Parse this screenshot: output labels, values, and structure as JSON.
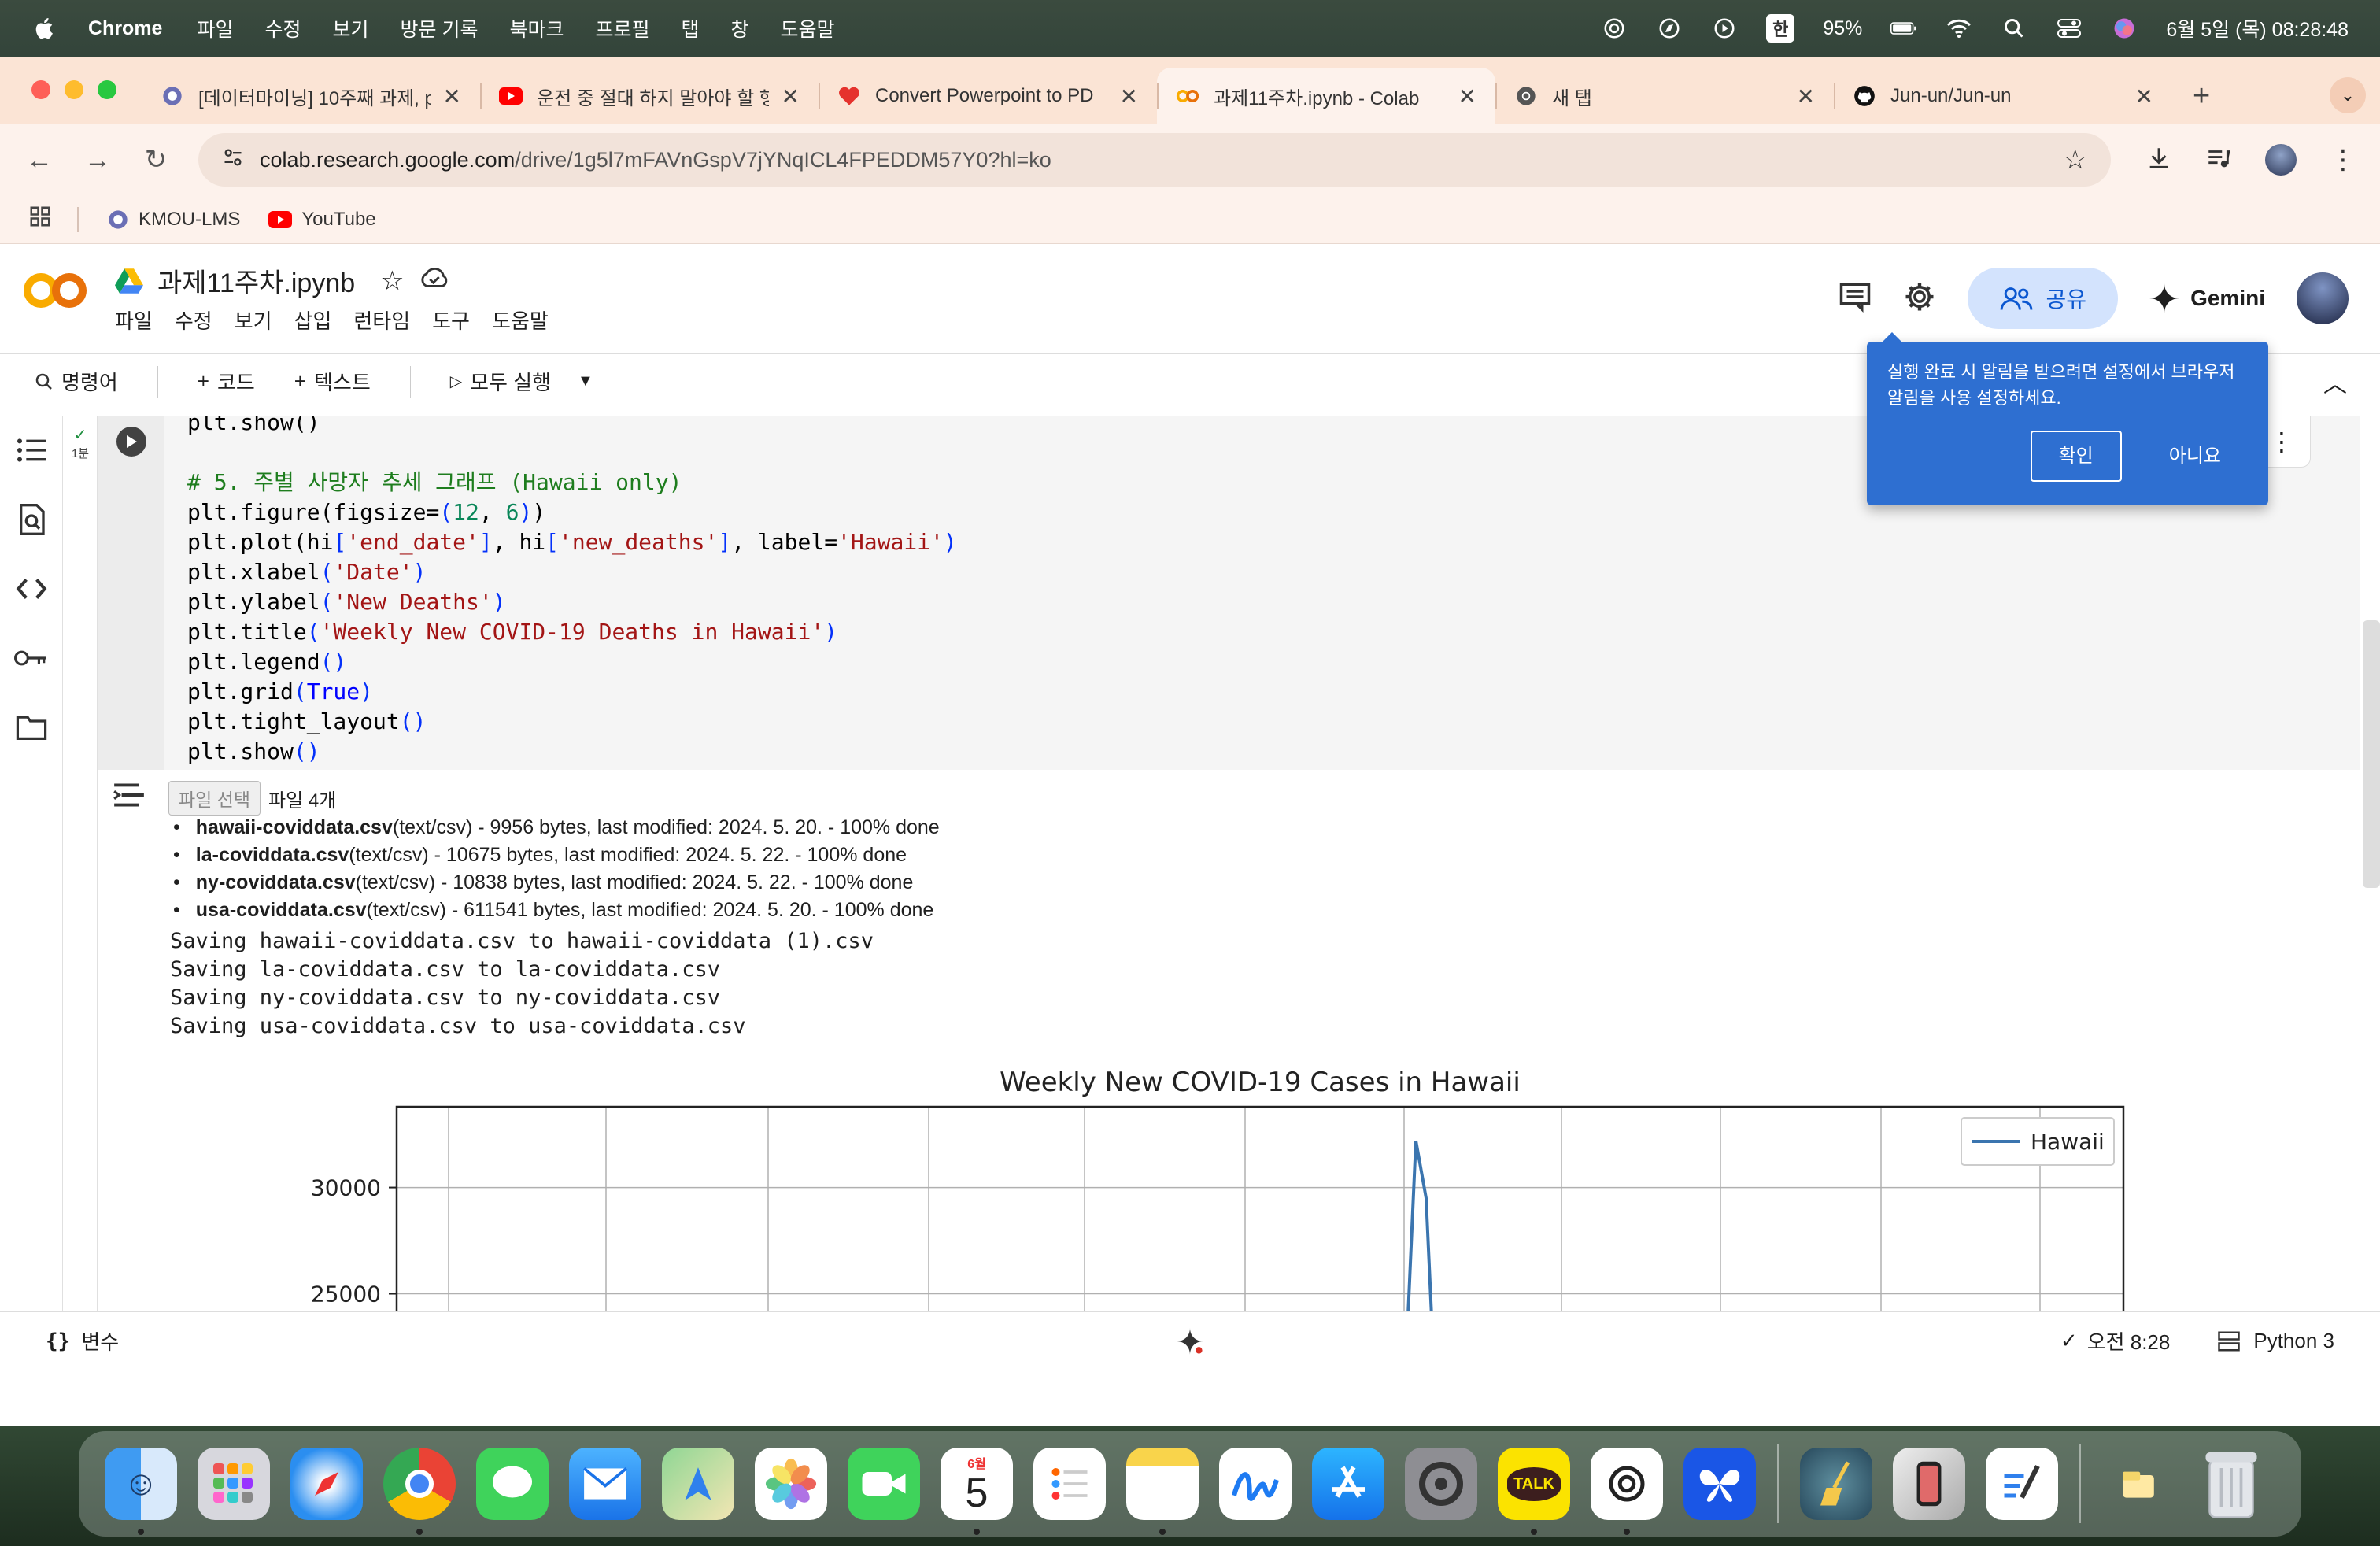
{
  "menubar": {
    "app_name": "Chrome",
    "items": [
      "파일",
      "수정",
      "보기",
      "방문 기록",
      "북마크",
      "프로필",
      "탭",
      "창",
      "도움말"
    ],
    "battery": "95%",
    "ime": "한",
    "datetime": "6월 5일 (목) 08:28:48"
  },
  "tabs": [
    {
      "title": "[데이터마이닝] 10주째 과제, p",
      "icon": "kmou-icon"
    },
    {
      "title": "운전 중 절대 하지 말아야 할 행",
      "icon": "youtube-icon"
    },
    {
      "title": "Convert Powerpoint to PD",
      "icon": "heart-icon"
    },
    {
      "title": "과제11주차.ipynb - Colab",
      "icon": "colab-icon",
      "active": true
    },
    {
      "title": "새 탭",
      "icon": "chrome-icon"
    },
    {
      "title": "Jun-un/Jun-un",
      "icon": "github-icon"
    }
  ],
  "address": {
    "host": "colab.research.google.com",
    "path": "/drive/1g5l7mFAVnGspV7jYNqICL4FPEDDM57Y0?hl=ko"
  },
  "bookmarks": [
    {
      "label": "KMOU-LMS",
      "icon": "kmou-icon"
    },
    {
      "label": "YouTube",
      "icon": "youtube-icon"
    }
  ],
  "notebook": {
    "title": "과제11주차.ipynb",
    "menu": [
      "파일",
      "수정",
      "보기",
      "삽입",
      "런타임",
      "도구",
      "도움말"
    ],
    "share_label": "공유",
    "gemini_label": "Gemini"
  },
  "colab_toolbar": {
    "commands": "명령어",
    "code": "코드",
    "text": "텍스트",
    "run_all": "모두 실행"
  },
  "cell": {
    "exec_time": "1분",
    "code_lines": [
      "plt.show()",
      "",
      "# 5. 주별 사망자 추세 그래프 (Hawaii only)",
      "plt.figure(figsize=(12, 6))",
      "plt.plot(hi['end_date'], hi['new_deaths'], label='Hawaii')",
      "plt.xlabel('Date')",
      "plt.ylabel('New Deaths')",
      "plt.title('Weekly New COVID-19 Deaths in Hawaii')",
      "plt.legend()",
      "plt.grid(True)",
      "plt.tight_layout()",
      "plt.show()"
    ]
  },
  "output": {
    "file_button": "파일 선택",
    "file_count": "파일 4개",
    "files": [
      {
        "name": "hawaii-coviddata.csv",
        "info": "(text/csv) - 9956 bytes, last modified: 2024. 5. 20. - 100% done"
      },
      {
        "name": "la-coviddata.csv",
        "info": "(text/csv) - 10675 bytes, last modified: 2024. 5. 22. - 100% done"
      },
      {
        "name": "ny-coviddata.csv",
        "info": "(text/csv) - 10838 bytes, last modified: 2024. 5. 22. - 100% done"
      },
      {
        "name": "usa-coviddata.csv",
        "info": "(text/csv) - 611541 bytes, last modified: 2024. 5. 20. - 100% done"
      }
    ],
    "saving": [
      "Saving hawaii-coviddata.csv to hawaii-coviddata (1).csv",
      "Saving la-coviddata.csv to la-coviddata.csv",
      "Saving ny-coviddata.csv to ny-coviddata.csv",
      "Saving usa-coviddata.csv to usa-coviddata.csv"
    ]
  },
  "chart_data": {
    "type": "line",
    "title": "Weekly New COVID-19 Cases in Hawaii",
    "series": [
      {
        "name": "Hawaii",
        "color": "#3b75af"
      }
    ],
    "y_ticks": [
      30000,
      25000
    ],
    "y_visible_range": [
      21500,
      33800
    ],
    "visible_peak": {
      "y": 32200
    },
    "legend": "top-right",
    "grid": true
  },
  "popup": {
    "text": "실행 완료 시 알림을 받으려면 설정에서 브라우저 알림을 사용 설정하세요.",
    "ok": "확인",
    "no": "아니요"
  },
  "statusbar": {
    "variables": "변수",
    "status": "오전 8:28",
    "runtime": "Python 3"
  }
}
